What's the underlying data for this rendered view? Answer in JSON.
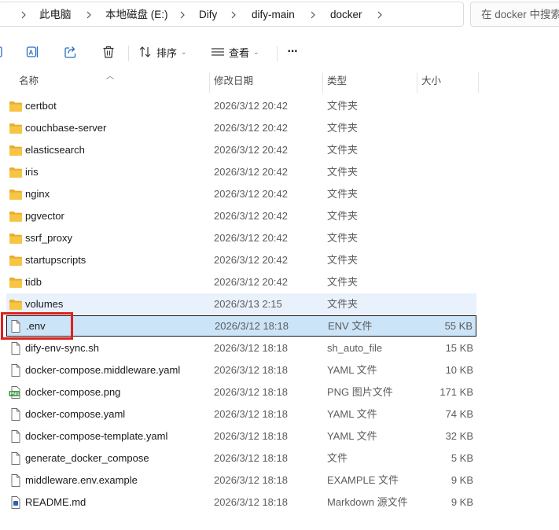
{
  "breadcrumb": {
    "items": [
      "此电脑",
      "本地磁盘 (E:)",
      "Dify",
      "dify-main",
      "docker"
    ]
  },
  "search": {
    "placeholder": "在 docker 中搜索"
  },
  "toolbar": {
    "sort_label": "排序",
    "view_label": "查看",
    "more_label": "···"
  },
  "columns": {
    "name": "名称",
    "date": "修改日期",
    "type": "类型",
    "size": "大小"
  },
  "files": [
    {
      "name": "certbot",
      "date": "2026/3/12 20:42",
      "type": "文件夹",
      "size": "",
      "icon": "folder-icon"
    },
    {
      "name": "couchbase-server",
      "date": "2026/3/12 20:42",
      "type": "文件夹",
      "size": "",
      "icon": "folder-icon"
    },
    {
      "name": "elasticsearch",
      "date": "2026/3/12 20:42",
      "type": "文件夹",
      "size": "",
      "icon": "folder-icon"
    },
    {
      "name": "iris",
      "date": "2026/3/12 20:42",
      "type": "文件夹",
      "size": "",
      "icon": "folder-icon"
    },
    {
      "name": "nginx",
      "date": "2026/3/12 20:42",
      "type": "文件夹",
      "size": "",
      "icon": "folder-icon"
    },
    {
      "name": "pgvector",
      "date": "2026/3/12 20:42",
      "type": "文件夹",
      "size": "",
      "icon": "folder-icon"
    },
    {
      "name": "ssrf_proxy",
      "date": "2026/3/12 20:42",
      "type": "文件夹",
      "size": "",
      "icon": "folder-icon"
    },
    {
      "name": "startupscripts",
      "date": "2026/3/12 20:42",
      "type": "文件夹",
      "size": "",
      "icon": "folder-icon"
    },
    {
      "name": "tidb",
      "date": "2026/3/12 20:42",
      "type": "文件夹",
      "size": "",
      "icon": "folder-icon"
    },
    {
      "name": "volumes",
      "date": "2026/3/13 2:15",
      "type": "文件夹",
      "size": "",
      "icon": "folder-icon"
    },
    {
      "name": ".env",
      "date": "2026/3/12 18:18",
      "type": "ENV 文件",
      "size": "55 KB",
      "icon": "file-icon"
    },
    {
      "name": "dify-env-sync.sh",
      "date": "2026/3/12 18:18",
      "type": "sh_auto_file",
      "size": "15 KB",
      "icon": "file-icon"
    },
    {
      "name": "docker-compose.middleware.yaml",
      "date": "2026/3/12 18:18",
      "type": "YAML 文件",
      "size": "10 KB",
      "icon": "file-icon"
    },
    {
      "name": "docker-compose.png",
      "date": "2026/3/12 18:18",
      "type": "PNG 图片文件",
      "size": "171 KB",
      "icon": "png-icon"
    },
    {
      "name": "docker-compose.yaml",
      "date": "2026/3/12 18:18",
      "type": "YAML 文件",
      "size": "74 KB",
      "icon": "file-icon"
    },
    {
      "name": "docker-compose-template.yaml",
      "date": "2026/3/12 18:18",
      "type": "YAML 文件",
      "size": "32 KB",
      "icon": "file-icon"
    },
    {
      "name": "generate_docker_compose",
      "date": "2026/3/12 18:18",
      "type": "文件",
      "size": "5 KB",
      "icon": "file-icon"
    },
    {
      "name": "middleware.env.example",
      "date": "2026/3/12 18:18",
      "type": "EXAMPLE 文件",
      "size": "9 KB",
      "icon": "file-icon"
    },
    {
      "name": "README.md",
      "date": "2026/3/12 18:18",
      "type": "Markdown 源文件",
      "size": "9 KB",
      "icon": "md-icon"
    }
  ],
  "selected_index": 10,
  "hover_index": 9,
  "colors": {
    "selection_bg": "#cce4f7",
    "hover_bg": "#e9f2fc",
    "highlight_outline": "#e0201b",
    "folder": "#f6c544"
  }
}
